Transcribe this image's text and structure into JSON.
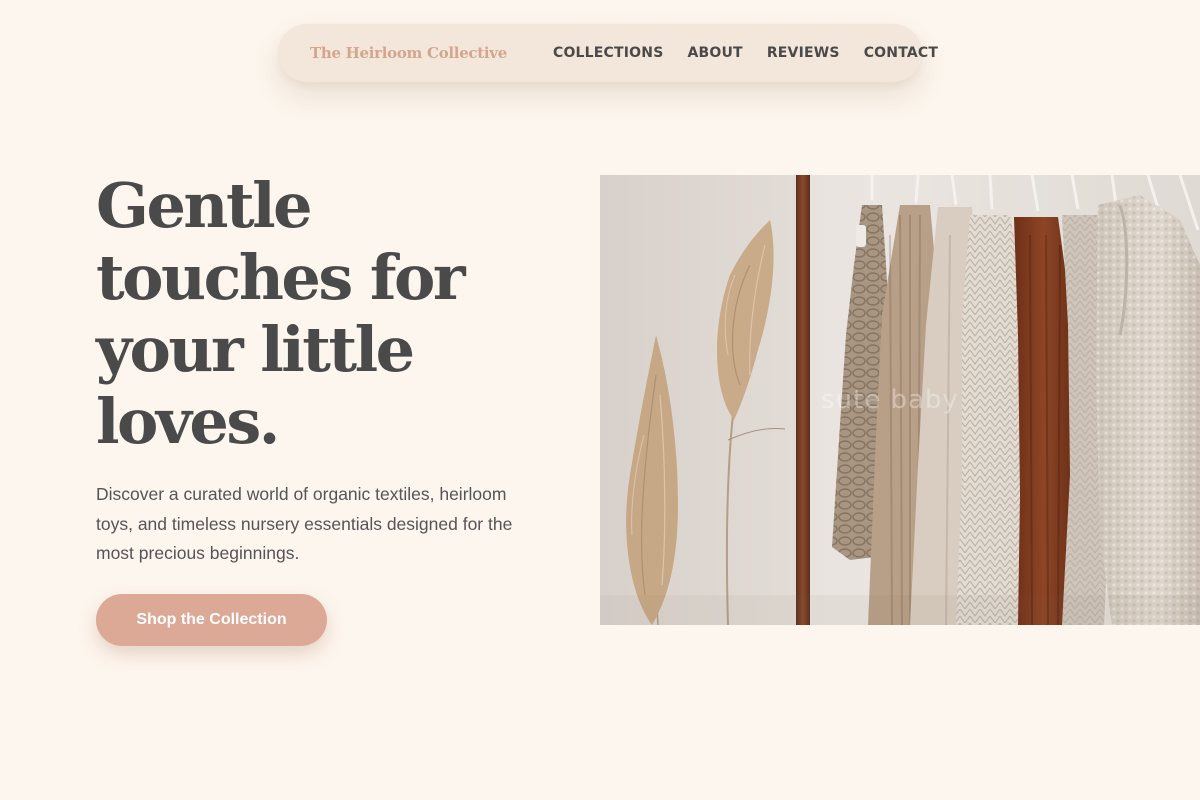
{
  "nav": {
    "brand": "The Heirloom Collective",
    "links": [
      {
        "label": "COLLECTIONS"
      },
      {
        "label": "ABOUT"
      },
      {
        "label": "REVIEWS"
      },
      {
        "label": "CONTACT"
      }
    ]
  },
  "hero": {
    "title_lines": [
      "Gentle",
      "touches for",
      "your little",
      "loves."
    ],
    "description": "Discover a curated world of organic textiles, heirloom toys, and timeless nursery essentials designed for the most precious beginnings.",
    "cta_label": "Shop the Collection",
    "image_watermark": "sute baby"
  },
  "colors": {
    "background": "#fdf6ee",
    "nav_background": "#f3e6da",
    "brand": "#d4a68e",
    "heading": "#4a4a4a",
    "cta_background": "#dba995"
  }
}
